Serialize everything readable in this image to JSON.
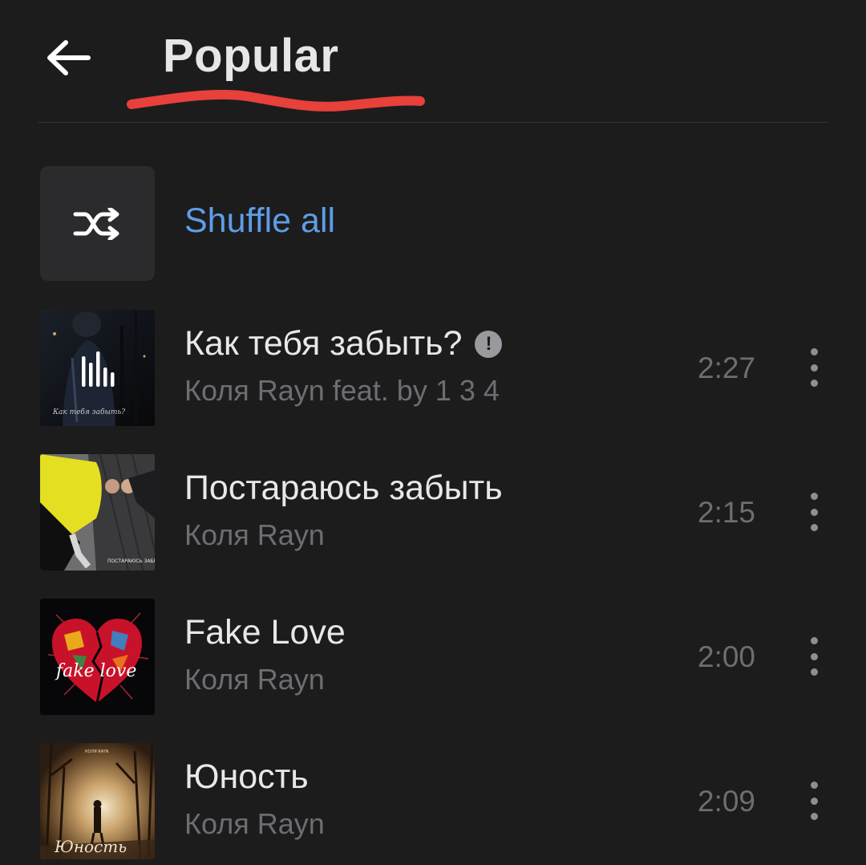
{
  "header": {
    "title": "Popular",
    "back_icon": "arrow-left-icon",
    "underline_color": "#e8403a"
  },
  "shuffle": {
    "label": "Shuffle all",
    "icon": "shuffle-icon",
    "accent": "#5e9de6"
  },
  "tracks": [
    {
      "title": "Как тебя забыть?",
      "artist": "Коля Rayn feat. by 1 3 4",
      "duration": "2:27",
      "explicit": true,
      "explicit_mark": "!",
      "now_playing": true,
      "cover_caption": "Как тебя забыть?"
    },
    {
      "title": "Постараюсь забыть",
      "artist": "Коля Rayn",
      "duration": "2:15",
      "explicit": false
    },
    {
      "title": "Fake Love",
      "artist": "Коля Rayn",
      "duration": "2:00",
      "explicit": false,
      "cover_caption": "fake love"
    },
    {
      "title": "Юность",
      "artist": "Коля Rayn",
      "duration": "2:09",
      "explicit": false,
      "cover_caption": "Юность"
    }
  ]
}
